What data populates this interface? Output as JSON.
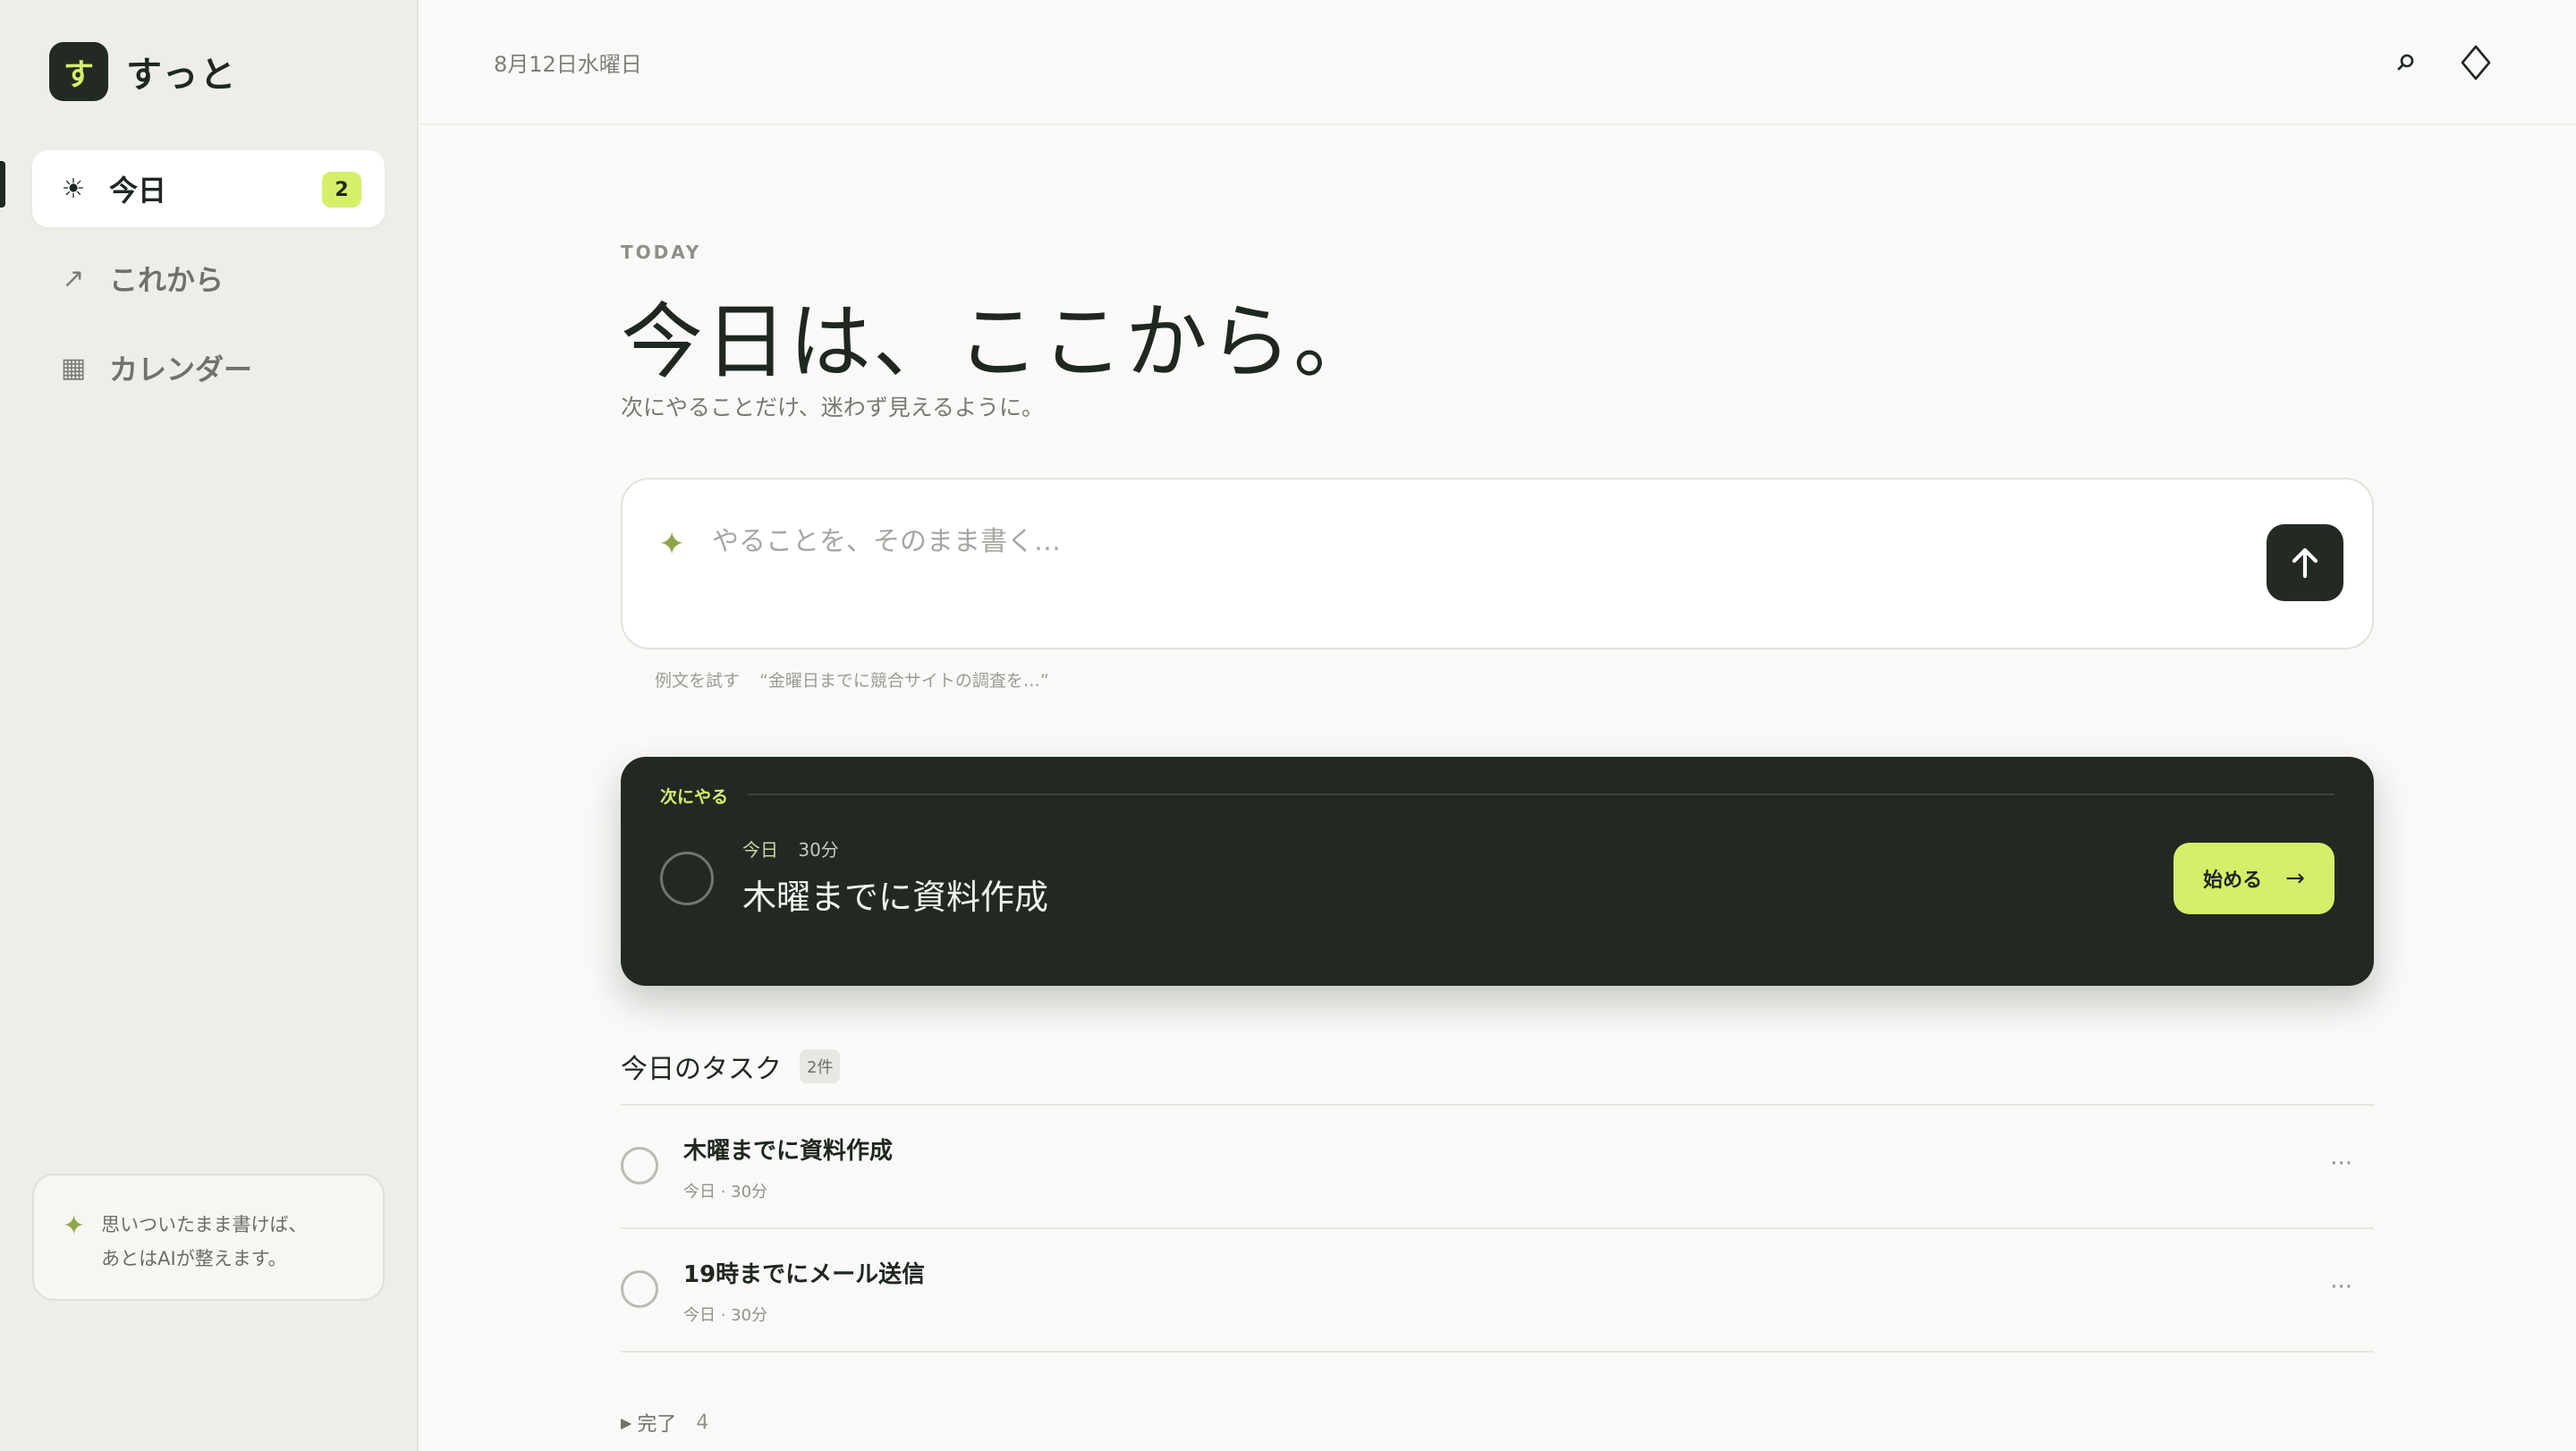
{
  "app": {
    "logo_glyph": "す",
    "name": "すっと"
  },
  "sidebar": {
    "items": [
      {
        "label": "今日",
        "icon": "sun-icon",
        "glyph": "☀",
        "badge": "2",
        "active": true
      },
      {
        "label": "これから",
        "icon": "arrow-up-right-icon",
        "glyph": "↗",
        "active": false
      },
      {
        "label": "カレンダー",
        "icon": "calendar-icon",
        "glyph": "▦",
        "active": false
      }
    ],
    "tip": {
      "line1": "思いついたまま書けば、",
      "line2": "あとはAIが整えます。"
    }
  },
  "header": {
    "date": "8月12日水曜日",
    "search_icon": "search-icon",
    "gem_icon": "diamond-icon"
  },
  "main": {
    "eyebrow": "TODAY",
    "title": "今日は、ここから。",
    "subtitle": "次にやることだけ、迷わず見えるように。",
    "composer": {
      "placeholder": "やることを、そのまま書く…",
      "value": ""
    },
    "example": {
      "label": "例文を試す",
      "text": "“金曜日までに競合サイトの調査を…”"
    },
    "next": {
      "label": "次にやる",
      "day": "今日",
      "duration": "30分",
      "title": "木曜までに資料作成",
      "start_label": "始める",
      "start_arrow": "→"
    },
    "tasks_section": {
      "title": "今日のタスク",
      "count": "2件"
    },
    "tasks": [
      {
        "title": "木曜までに資料作成",
        "meta": "今日 · 30分",
        "more": "···"
      },
      {
        "title": "19時までにメール送信",
        "meta": "今日 · 30分",
        "more": "···"
      }
    ],
    "done": {
      "label": "完了",
      "count": "4"
    }
  },
  "colors": {
    "accent": "#d4f06a",
    "dark": "#222923",
    "sparkle": "#8da64a",
    "background": "#f9f9f7"
  }
}
